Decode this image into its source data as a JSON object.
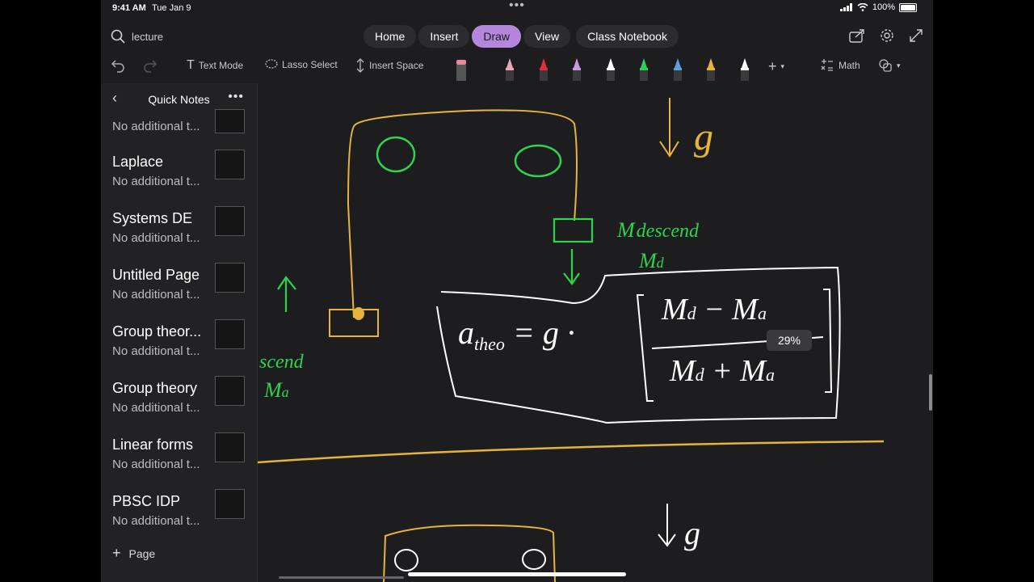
{
  "status_bar": {
    "time": "9:41 AM",
    "date": "Tue Jan 9",
    "battery": "100%"
  },
  "search": {
    "query": "lecture"
  },
  "tabs": [
    {
      "label": "Home"
    },
    {
      "label": "Insert"
    },
    {
      "label": "Draw"
    },
    {
      "label": "View"
    },
    {
      "label": "Class Notebook"
    }
  ],
  "active_tab": "Draw",
  "toolbar": {
    "text_mode": "Text Mode",
    "lasso_select": "Lasso Select",
    "insert_space": "Insert Space",
    "math": "Math",
    "pens": [
      {
        "color": "#e9a7b7"
      },
      {
        "color": "#e0303a"
      },
      {
        "color": "#c79ad8"
      },
      {
        "color": "#ffffff"
      },
      {
        "color": "#28d25a"
      },
      {
        "color": "#5fa0e0"
      },
      {
        "color": "#e6b43c"
      },
      {
        "color": "#ffffff"
      }
    ]
  },
  "sidebar": {
    "title": "Quick Notes",
    "add_label": "Page",
    "pages": [
      {
        "title": "",
        "subtitle": "No additional t..."
      },
      {
        "title": "Laplace",
        "subtitle": "No additional t..."
      },
      {
        "title": "Systems DE",
        "subtitle": "No additional t..."
      },
      {
        "title": "Untitled Page",
        "subtitle": "No additional t..."
      },
      {
        "title": "Group theor...",
        "subtitle": "No additional t..."
      },
      {
        "title": "Group theory",
        "subtitle": "No additional t..."
      },
      {
        "title": "Linear forms",
        "subtitle": "No additional t..."
      },
      {
        "title": "PBSC IDP",
        "subtitle": "No additional t..."
      }
    ]
  },
  "canvas": {
    "zoom": "29%",
    "ink_colors": {
      "green": "#2fd34d",
      "gold": "#e6b43c",
      "white": "#ffffff"
    }
  }
}
